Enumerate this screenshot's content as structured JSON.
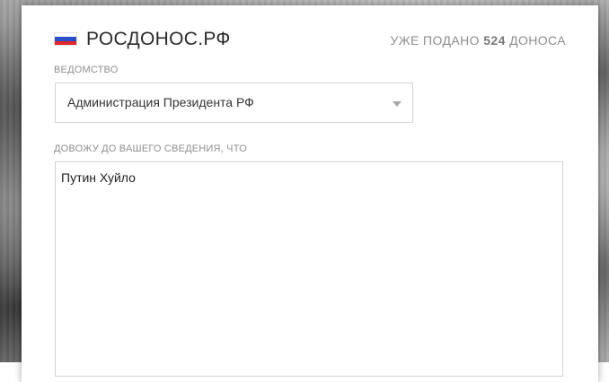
{
  "header": {
    "site_title": "РОСДОНОС.РФ",
    "counter_prefix": "УЖЕ ПОДАНО",
    "counter_value": "524",
    "counter_suffix": "ДОНОСА",
    "flag_icon": "russian-flag-icon"
  },
  "form": {
    "agency_label": "ВЕДОМСТВО",
    "agency_value": "Администрация Президента РФ",
    "report_label": "ДОВОЖУ ДО ВАШЕГО СВЕДЕНИЯ, ЧТО",
    "report_text": "Путин Хуйло"
  },
  "colors": {
    "flag_white": "#ffffff",
    "flag_blue": "#2a4fc8",
    "flag_red": "#e0262b",
    "label_gray": "#8f8f8f",
    "border_gray": "#d3d3d3"
  }
}
